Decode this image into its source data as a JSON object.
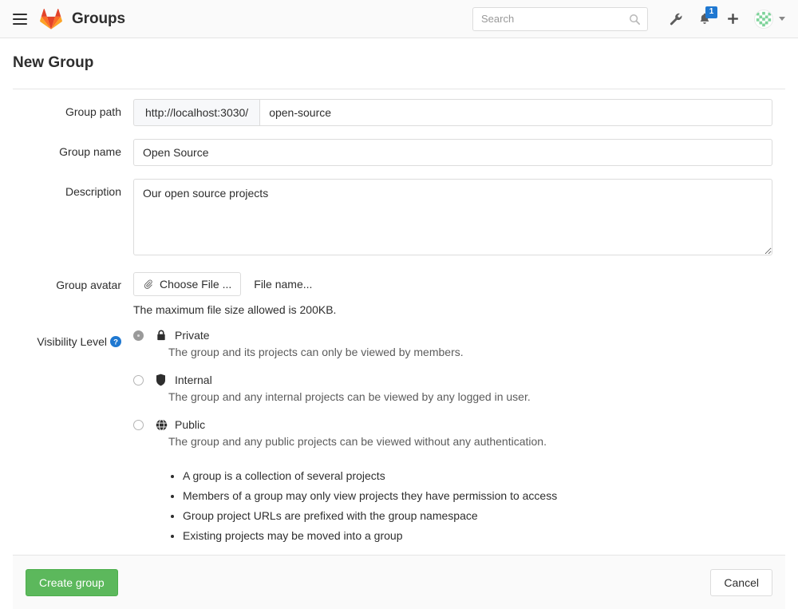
{
  "navbar": {
    "menu_icon": "hamburger-icon",
    "logo_icon": "gitlab-logo-icon",
    "title": "Groups",
    "search": {
      "value": "",
      "placeholder": "Search",
      "icon": "search-icon"
    },
    "settings_icon": "wrench-icon",
    "notifications": {
      "icon": "bell-icon",
      "count": "1"
    },
    "new_icon": "plus-icon",
    "avatar": {
      "icon": "user-avatar-icon",
      "caret": "chevron-down-icon"
    }
  },
  "page": {
    "title": "New Group"
  },
  "form": {
    "group_path": {
      "label": "Group path",
      "prefix": "http://localhost:3030/",
      "value": "open-source",
      "placeholder": ""
    },
    "group_name": {
      "label": "Group name",
      "value": "Open Source",
      "placeholder": ""
    },
    "description": {
      "label": "Description",
      "value": "Our open source projects",
      "placeholder": ""
    },
    "group_avatar": {
      "label": "Group avatar",
      "choose_button": "Choose File ...",
      "choose_icon": "paperclip-icon",
      "file_name": "File name...",
      "hint": "The maximum file size allowed is 200KB."
    },
    "visibility": {
      "label": "Visibility Level",
      "help_icon": "question-circle-icon",
      "selected": "private",
      "options": [
        {
          "id": "private",
          "icon": "lock-icon",
          "name": "Private",
          "description": "The group and its projects can only be viewed by members.",
          "checked": true
        },
        {
          "id": "internal",
          "icon": "shield-icon",
          "name": "Internal",
          "description": "The group and any internal projects can be viewed by any logged in user.",
          "checked": false
        },
        {
          "id": "public",
          "icon": "globe-icon",
          "name": "Public",
          "description": "The group and any public projects can be viewed without any authentication.",
          "checked": false
        }
      ],
      "bullets": [
        "A group is a collection of several projects",
        "Members of a group may only view projects they have permission to access",
        "Group project URLs are prefixed with the group namespace",
        "Existing projects may be moved into a group"
      ]
    }
  },
  "footer": {
    "submit_label": "Create group",
    "cancel_label": "Cancel"
  },
  "colors": {
    "primary_green": "#5cb85c",
    "badge_blue": "#1f78d1",
    "help_blue": "#1f78d1",
    "gitlab_orange": "#e24329"
  }
}
